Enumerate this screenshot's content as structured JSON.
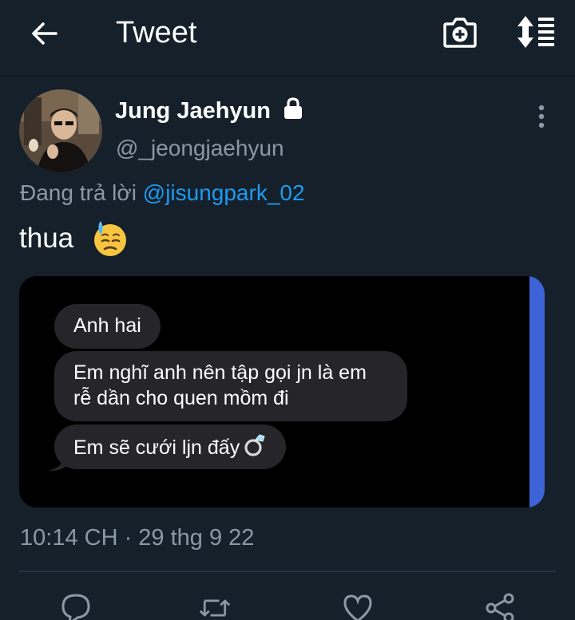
{
  "header": {
    "title": "Tweet",
    "back_icon": "arrow-left-icon",
    "camera_icon": "camera-plus-icon",
    "sort_icon": "sort-list-icon"
  },
  "tweet": {
    "author": {
      "name": "Jung Jaehyun",
      "handle": "@_jeongjaehyun",
      "protected": true
    },
    "reply_prefix": "Đang trả lời ",
    "reply_to": "@jisungpark_02",
    "text": "thua",
    "text_emoji": "downcast-face-with-sweat",
    "media": {
      "messages": [
        "Anh hai",
        "Em nghĩ anh nên tập gọi jn là em rễ dần cho quen mồm đi",
        "Em sẽ cưới ljn đấy"
      ],
      "last_message_emoji": "ring"
    },
    "timestamp": "10:14 CH · 29 thg 9 22"
  },
  "actions": [
    "reply",
    "retweet",
    "like",
    "share"
  ],
  "colors": {
    "background": "#15202b",
    "secondary_text": "#8b98a5",
    "link": "#1d9bf0",
    "bubble": "#26252a",
    "stripe": "#3c64d6"
  }
}
